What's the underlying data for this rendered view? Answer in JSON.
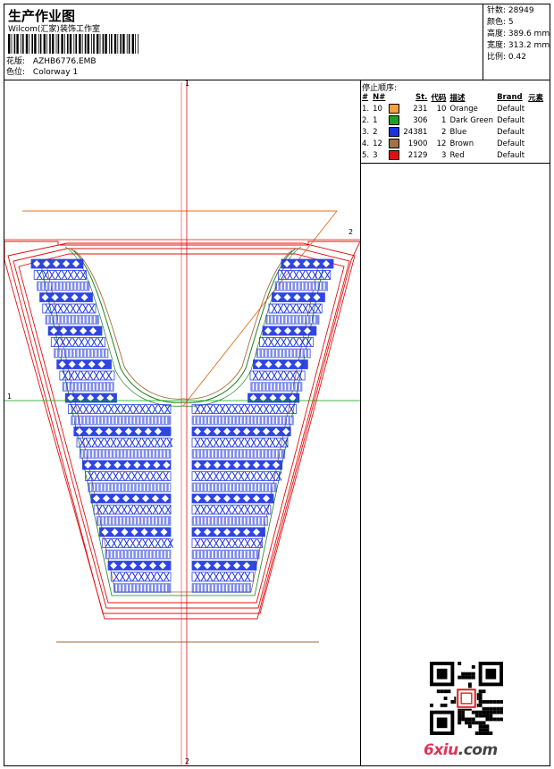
{
  "header": {
    "title": "生产作业图",
    "company": "Wilcom(汇家)装饰工作室",
    "design_label": "花版:",
    "design_value": "AZHB6776.EMB",
    "color_label": "色位:",
    "color_value": "Colorway 1"
  },
  "stats": [
    {
      "label": "针数:",
      "value": "28949"
    },
    {
      "label": "颜色:",
      "value": "5"
    },
    {
      "label": "高度:",
      "value": "389.6 mm"
    },
    {
      "label": "宽度:",
      "value": "313.2 mm"
    },
    {
      "label": "比例:",
      "value": "0.42"
    }
  ],
  "stop_sequence": {
    "heading": "停止顺序:",
    "columns": [
      "#",
      "N#",
      "St.",
      "代码",
      "描述",
      "Brand",
      "元素"
    ],
    "rows": [
      {
        "idx": "1.",
        "n": "10",
        "color": "#f0a040",
        "st": "231",
        "code": "10",
        "desc": "Orange",
        "brand": "Default"
      },
      {
        "idx": "2.",
        "n": "1",
        "color": "#20a020",
        "st": "306",
        "code": "1",
        "desc": "Dark Green",
        "brand": "Default"
      },
      {
        "idx": "3.",
        "n": "2",
        "color": "#1a33e0",
        "st": "24381",
        "code": "2",
        "desc": "Blue",
        "brand": "Default"
      },
      {
        "idx": "4.",
        "n": "12",
        "color": "#a0724a",
        "st": "1900",
        "code": "12",
        "desc": "Brown",
        "brand": "Default"
      },
      {
        "idx": "5.",
        "n": "3",
        "color": "#e01010",
        "st": "2129",
        "code": "3",
        "desc": "Red",
        "brand": "Default"
      }
    ]
  },
  "axes": {
    "top": "1",
    "bottom": "2",
    "left": "1",
    "right": "2"
  },
  "watermark": {
    "brand": "6xiu",
    "tld": ".com"
  },
  "colors": {
    "blue": "#1a33e0",
    "red": "#e01010",
    "green": "#208020",
    "brown": "#a06a3a",
    "orange": "#e07020"
  }
}
